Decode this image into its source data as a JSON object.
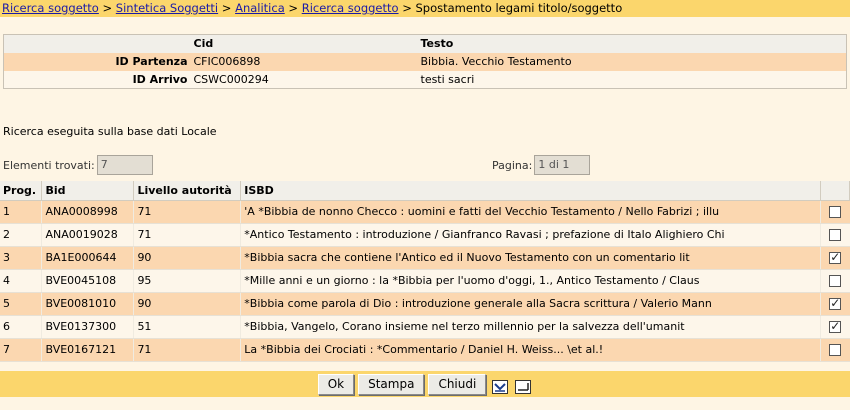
{
  "breadcrumb": {
    "links": [
      "Ricerca soggetto",
      "Sintetica Soggetti",
      "Analitica",
      "Ricerca soggetto"
    ],
    "separator": ">",
    "current": "Spostamento legami titolo/soggetto"
  },
  "header_table": {
    "col_cid": "Cid",
    "col_testo": "Testo",
    "rows": [
      {
        "label": "ID Partenza",
        "cid": "CFIC006898",
        "testo": "Bibbia. Vecchio Testamento"
      },
      {
        "label": "ID Arrivo",
        "cid": "CSWC000294",
        "testo": "testi sacri"
      }
    ]
  },
  "search_info": "Ricerca eseguita sulla base dati Locale",
  "counters": {
    "found_label": "Elementi trovati:",
    "found_value": "7",
    "page_label": "Pagina:",
    "page_value": "1 di 1"
  },
  "results": {
    "headers": {
      "prog": "Prog.",
      "bid": "Bid",
      "livello": "Livello autorità",
      "isbd": "ISBD"
    },
    "rows": [
      {
        "prog": "1",
        "bid": "ANA0008998",
        "livello": "71",
        "isbd": "'A *Bibbia de nonno Checco : uomini e fatti del Vecchio Testamento / Nello Fabrizi ; illu",
        "checked": false
      },
      {
        "prog": "2",
        "bid": "ANA0019028",
        "livello": "71",
        "isbd": "*Antico Testamento : introduzione / Gianfranco Ravasi ; prefazione di Italo Alighiero Chi",
        "checked": false
      },
      {
        "prog": "3",
        "bid": "BA1E000644",
        "livello": "90",
        "isbd": "*Bibbia sacra che contiene l'Antico ed il Nuovo Testamento con un comentario lit",
        "checked": true
      },
      {
        "prog": "4",
        "bid": "BVE0045108",
        "livello": "95",
        "isbd": "*Mille anni e un giorno : la *Bibbia per l'uomo d'oggi, 1., Antico Testamento / Claus",
        "checked": false
      },
      {
        "prog": "5",
        "bid": "BVE0081010",
        "livello": "90",
        "isbd": "*Bibbia come parola di Dio : introduzione generale alla Sacra scrittura / Valerio Mann",
        "checked": true
      },
      {
        "prog": "6",
        "bid": "BVE0137300",
        "livello": "51",
        "isbd": "*Bibbia, Vangelo, Corano insieme nel terzo millennio per la salvezza dell'umanit",
        "checked": true
      },
      {
        "prog": "7",
        "bid": "BVE0167121",
        "livello": "71",
        "isbd": "La *Bibbia dei Crociati : *Commentario / Daniel H. Weiss... \\et al.!",
        "checked": false
      }
    ]
  },
  "footer": {
    "ok_label": "Ok",
    "stampa_label": "Stampa",
    "chiudi_label": "Chiudi",
    "icons": [
      "select-all-icon",
      "deselect-all-icon"
    ]
  },
  "colors": {
    "bar": "#fbd66c",
    "row_odd": "#fbd7b0",
    "row_even": "#fdf6ea",
    "background": "#fef5e4",
    "link": "#1a1aa8"
  }
}
